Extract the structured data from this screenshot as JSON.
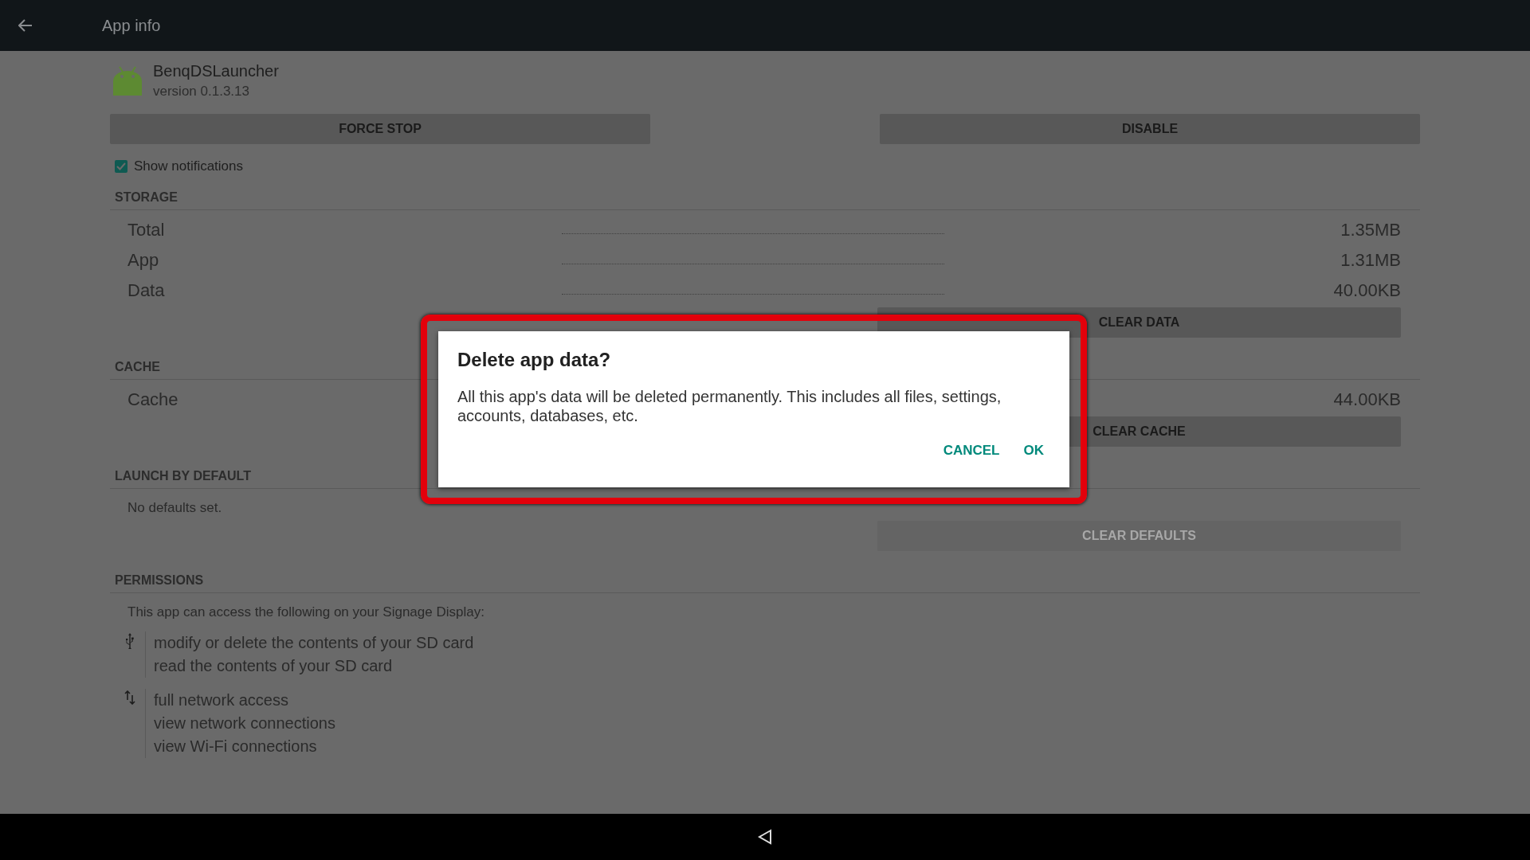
{
  "app_bar": {
    "title": "App info"
  },
  "app": {
    "name": "BenqDSLauncher",
    "version": "version 0.1.3.13"
  },
  "action_buttons": [
    {
      "label": "FORCE STOP",
      "disabled": false
    },
    {
      "label": "DISABLE",
      "disabled": false
    }
  ],
  "notifications": {
    "label": "Show notifications",
    "checked": true
  },
  "storage": {
    "header": "STORAGE",
    "rows": [
      {
        "label": "Total",
        "value": "1.35MB"
      },
      {
        "label": "App",
        "value": "1.31MB"
      },
      {
        "label": "Data",
        "value": "40.00KB"
      }
    ],
    "button": {
      "label": "CLEAR DATA",
      "disabled": false
    }
  },
  "cache": {
    "header": "CACHE",
    "rows": [
      {
        "label": "Cache",
        "value": "44.00KB"
      }
    ],
    "button": {
      "label": "CLEAR CACHE",
      "disabled": false
    }
  },
  "launch": {
    "header": "LAUNCH BY DEFAULT",
    "text": "No defaults set.",
    "button": {
      "label": "CLEAR DEFAULTS",
      "disabled": true
    }
  },
  "permissions": {
    "header": "PERMISSIONS",
    "intro": "This app can access the following on your Signage Display:",
    "groups": [
      {
        "kind": "storage",
        "items": [
          "modify or delete the contents of your SD card",
          "read the contents of your SD card"
        ]
      },
      {
        "kind": "network",
        "items": [
          "full network access",
          "view network connections",
          "view Wi-Fi connections"
        ]
      }
    ]
  },
  "dialog": {
    "title": "Delete app data?",
    "message": "All this app's data will be deleted permanently. This includes all files, settings, accounts, databases, etc.",
    "buttons": [
      "CANCEL",
      "OK"
    ]
  }
}
